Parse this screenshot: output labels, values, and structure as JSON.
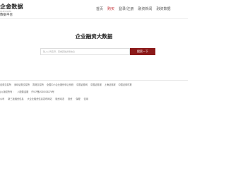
{
  "header": {
    "logo_main": "企金数据",
    "logo_sub": "QIJIN DATA",
    "logo_tag": "数据平台",
    "nav": [
      {
        "label": "首页",
        "active": false
      },
      {
        "label": "购买",
        "active": true
      },
      {
        "label": "登录/注册",
        "active": false
      },
      {
        "label": "融资新闻",
        "active": false
      },
      {
        "label": "融资数据",
        "active": false
      }
    ]
  },
  "hero": {
    "title": "企业融资大数据",
    "search_placeholder": "输入公司名称、查看其融资等信息",
    "search_button": "搜索一下"
  },
  "footer": {
    "links": [
      "证券交易所",
      "深圳证券交易所",
      "香港交易所",
      "全国中小企业股份转让系统",
      "中国证券网",
      "中国证券报",
      "上海证券报",
      "中国证券时报"
    ],
    "copyright": [
      "(c) 版权所有：",
      "川投数金服",
      "沪ICP备2020035376号"
    ],
    "bottom_links": [
      "公司",
      "新三板融资信息",
      "大企业融资信息发布网站",
      "融资动态",
      "投资",
      "保理",
      "信用"
    ]
  },
  "colors": {
    "accent": "#c0272d",
    "button": "#8b1a1a"
  }
}
